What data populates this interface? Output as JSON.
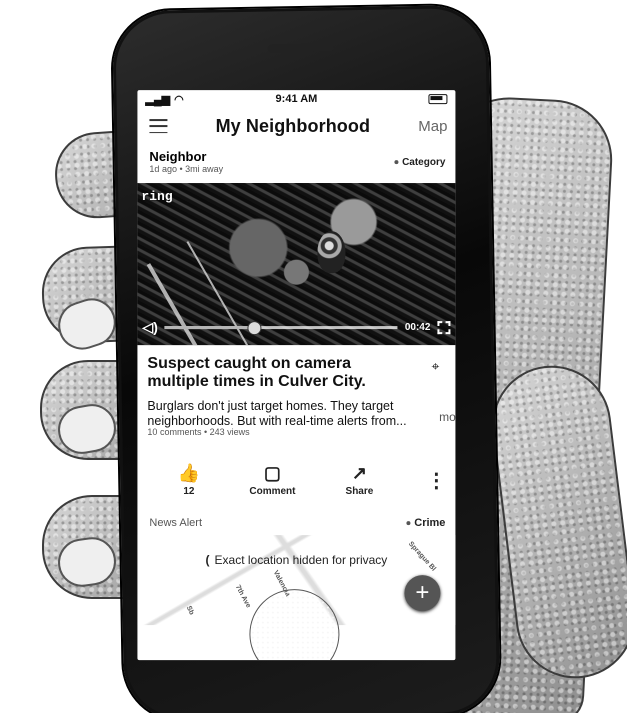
{
  "status_bar": {
    "time": "9:41 AM",
    "signal_icon": "signal-icon",
    "wifi_icon": "wifi-icon",
    "battery_icon": "battery-icon"
  },
  "header": {
    "menu_icon": "menu-icon",
    "title": "My Neighborhood",
    "map_label": "Map"
  },
  "post": {
    "author": "Neighbor",
    "meta": "1d ago • 3mi away",
    "category": "Category"
  },
  "video": {
    "brand": "ring",
    "time": "00:42",
    "progress": 0.38
  },
  "article": {
    "title": "Suspect caught on camera multiple times in Culver City.",
    "excerpt": "Burglars don't just target homes. They target neighborhoods. But with real-time alerts from...",
    "more": "more",
    "stats": "10 comments • 243 views"
  },
  "actions": {
    "like_count": "12",
    "comment_label": "Comment",
    "share_label": "Share"
  },
  "news_alert": {
    "title": "News Alert",
    "category": "Crime"
  },
  "map_preview": {
    "privacy_text": "Exact location hidden for privacy",
    "street_labels": [
      "7th Ave",
      "Valencia",
      "Sb",
      "Sprague Bl"
    ]
  },
  "floating_action": {
    "symbol": "+"
  }
}
